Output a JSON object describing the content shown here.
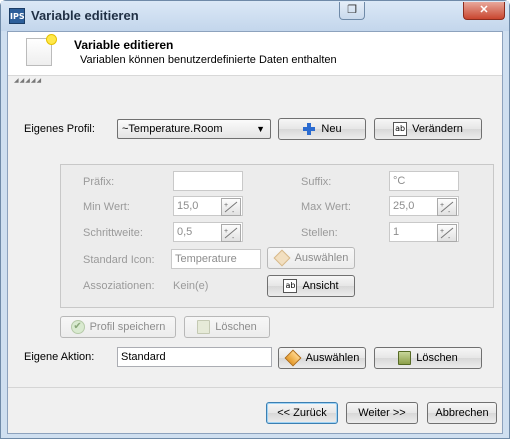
{
  "window": {
    "title": "Variable editieren",
    "app_icon_text": "IPS",
    "restore_glyph": "❐",
    "close_glyph": "✕"
  },
  "header": {
    "title": "Variable editieren",
    "subtitle": "Variablen können benutzerdefinierte Daten enthalten"
  },
  "profile": {
    "label": "Eigenes Profil:",
    "selected": "~Temperature.Room",
    "new_button": "Neu",
    "change_button": "Verändern"
  },
  "profile_details": {
    "prefix_label": "Präfix:",
    "prefix_value": "",
    "suffix_label": "Suffix:",
    "suffix_value": "°C",
    "min_label": "Min Wert:",
    "min_value": "15,0",
    "max_label": "Max Wert:",
    "max_value": "25,0",
    "step_label": "Schrittweite:",
    "step_value": "0,5",
    "digits_label": "Stellen:",
    "digits_value": "1",
    "icon_label": "Standard Icon:",
    "icon_value": "Temperature",
    "icon_select_button": "Auswählen",
    "assoc_label": "Assoziationen:",
    "assoc_value": "Kein(e)",
    "view_button": "Ansicht"
  },
  "profile_actions": {
    "save_button": "Profil speichern",
    "delete_button": "Löschen"
  },
  "action": {
    "label": "Eigene Aktion:",
    "value": "Standard",
    "select_button": "Auswählen",
    "delete_button": "Löschen"
  },
  "footer": {
    "back_button": "<< Zurück",
    "next_button": "Weiter >>",
    "cancel_button": "Abbrechen"
  }
}
